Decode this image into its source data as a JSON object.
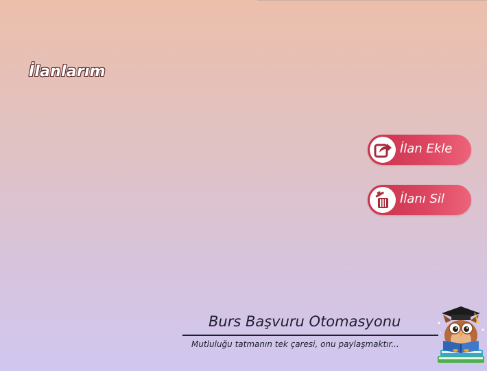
{
  "page": {
    "title": "İlanlarım"
  },
  "actions": {
    "add_label": "İlan Ekle",
    "add_icon": "share-arrow-icon",
    "delete_label": "İlanı Sil",
    "delete_icon": "trash-icon"
  },
  "footer": {
    "app_name": "Burs Başvuru Otomasyonu",
    "slogan": "Mutluluğu tatmanın tek çaresi, onu paylaşmaktır..."
  },
  "mascot": {
    "icon": "graduate-owl-icon"
  },
  "colors": {
    "button_start": "#c8324a",
    "button_end": "#ed6479",
    "icon_color": "#a82a3a",
    "background_top": "#ecbfab",
    "background_bottom": "#d0c7f0"
  }
}
